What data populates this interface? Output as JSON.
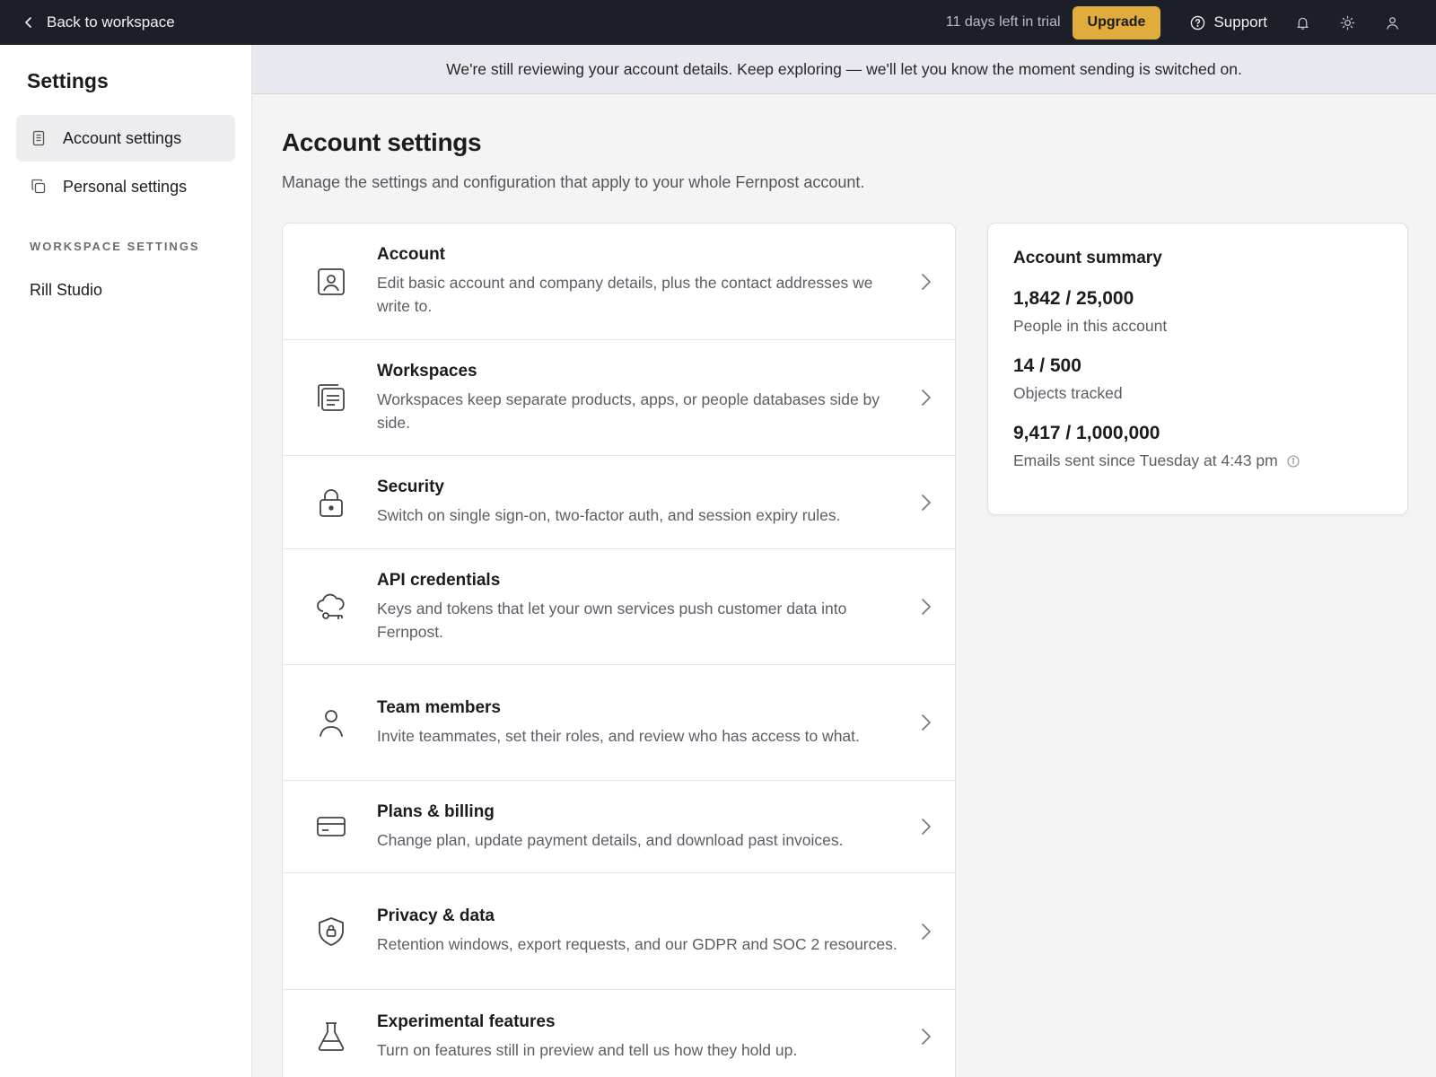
{
  "topbar": {
    "back_label": "Back to workspace",
    "trial_text": "11 days left in trial",
    "upgrade_label": "Upgrade",
    "support_label": "Support"
  },
  "banner": {
    "message": "We're still reviewing your account details. Keep exploring — we'll let you know the moment sending is switched on."
  },
  "sidebar": {
    "title": "Settings",
    "items": [
      {
        "label": "Account settings",
        "icon": "document-icon",
        "active": true
      },
      {
        "label": "Personal settings",
        "icon": "copy-icon",
        "active": false
      }
    ],
    "section_label": "WORKSPACE SETTINGS",
    "workspaces": [
      {
        "label": "Rill Studio"
      }
    ]
  },
  "main": {
    "title": "Account settings",
    "subtitle": "Manage the settings and configuration that apply to your whole Fernpost account.",
    "cards": [
      {
        "title": "Account",
        "desc": "Edit basic account and company details, plus the contact addresses we write to.",
        "icon": "id-card-icon"
      },
      {
        "title": "Workspaces",
        "desc": "Workspaces keep separate products, apps, or people databases side by side.",
        "icon": "stacked-docs-icon"
      },
      {
        "title": "Security",
        "desc": "Switch on single sign-on, two-factor auth, and session expiry rules.",
        "icon": "lock-icon"
      },
      {
        "title": "API credentials",
        "desc": "Keys and tokens that let your own services push customer data into Fernpost.",
        "icon": "cloud-key-icon"
      },
      {
        "title": "Team members",
        "desc": "Invite teammates, set their roles, and review who has access to what.",
        "icon": "person-icon"
      },
      {
        "title": "Plans & billing",
        "desc": "Change plan, update payment details, and download past invoices.",
        "icon": "credit-card-icon"
      },
      {
        "title": "Privacy & data",
        "desc": "Retention windows, export requests, and our GDPR and SOC 2 resources.",
        "icon": "shield-lock-icon"
      },
      {
        "title": "Experimental features",
        "desc": "Turn on features still in preview and tell us how they hold up.",
        "icon": "flask-icon"
      }
    ]
  },
  "summary": {
    "title": "Account summary",
    "stats": [
      {
        "value": "1,842 / 25,000",
        "label": "People in this account"
      },
      {
        "value": "14 / 500",
        "label": "Objects tracked"
      },
      {
        "value": "9,417 / 1,000,000",
        "label": "Emails sent since Tuesday at 4:43 pm"
      }
    ]
  },
  "colors": {
    "topbar_bg": "#1c1f27",
    "upgrade_bg": "#e0ac3c",
    "banner_bg": "#e8e9ee"
  }
}
